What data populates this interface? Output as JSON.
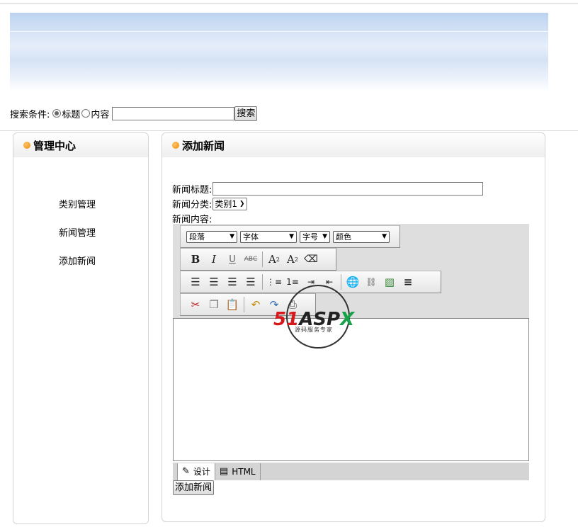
{
  "search": {
    "label": "搜索条件:",
    "option_title": "标题",
    "option_content": "内容",
    "selected": "标题",
    "value": "",
    "button": "搜索"
  },
  "sidebar": {
    "title": "管理中心",
    "items": [
      {
        "label": "类别管理"
      },
      {
        "label": "新闻管理"
      },
      {
        "label": "添加新闻"
      }
    ]
  },
  "main": {
    "title": "添加新闻",
    "form": {
      "title_label": "新闻标题:",
      "title_value": "",
      "category_label": "新闻分类:",
      "category_value": "类别1",
      "content_label": "新闻内容:"
    },
    "editor": {
      "paragraph_select": "段落",
      "font_select": "字体",
      "size_select": "字号",
      "color_select": "颜色",
      "mode_design": "设计",
      "mode_html": "HTML",
      "active_mode": "设计"
    },
    "submit_button": "添加新闻"
  },
  "watermark": {
    "brand_red": "51",
    "brand_dark": "ASP",
    "brand_green": "X",
    "tagline": "源码服务专家"
  },
  "colors": {
    "accent_dot": "#f08a00",
    "banner": "#c8daf1"
  }
}
